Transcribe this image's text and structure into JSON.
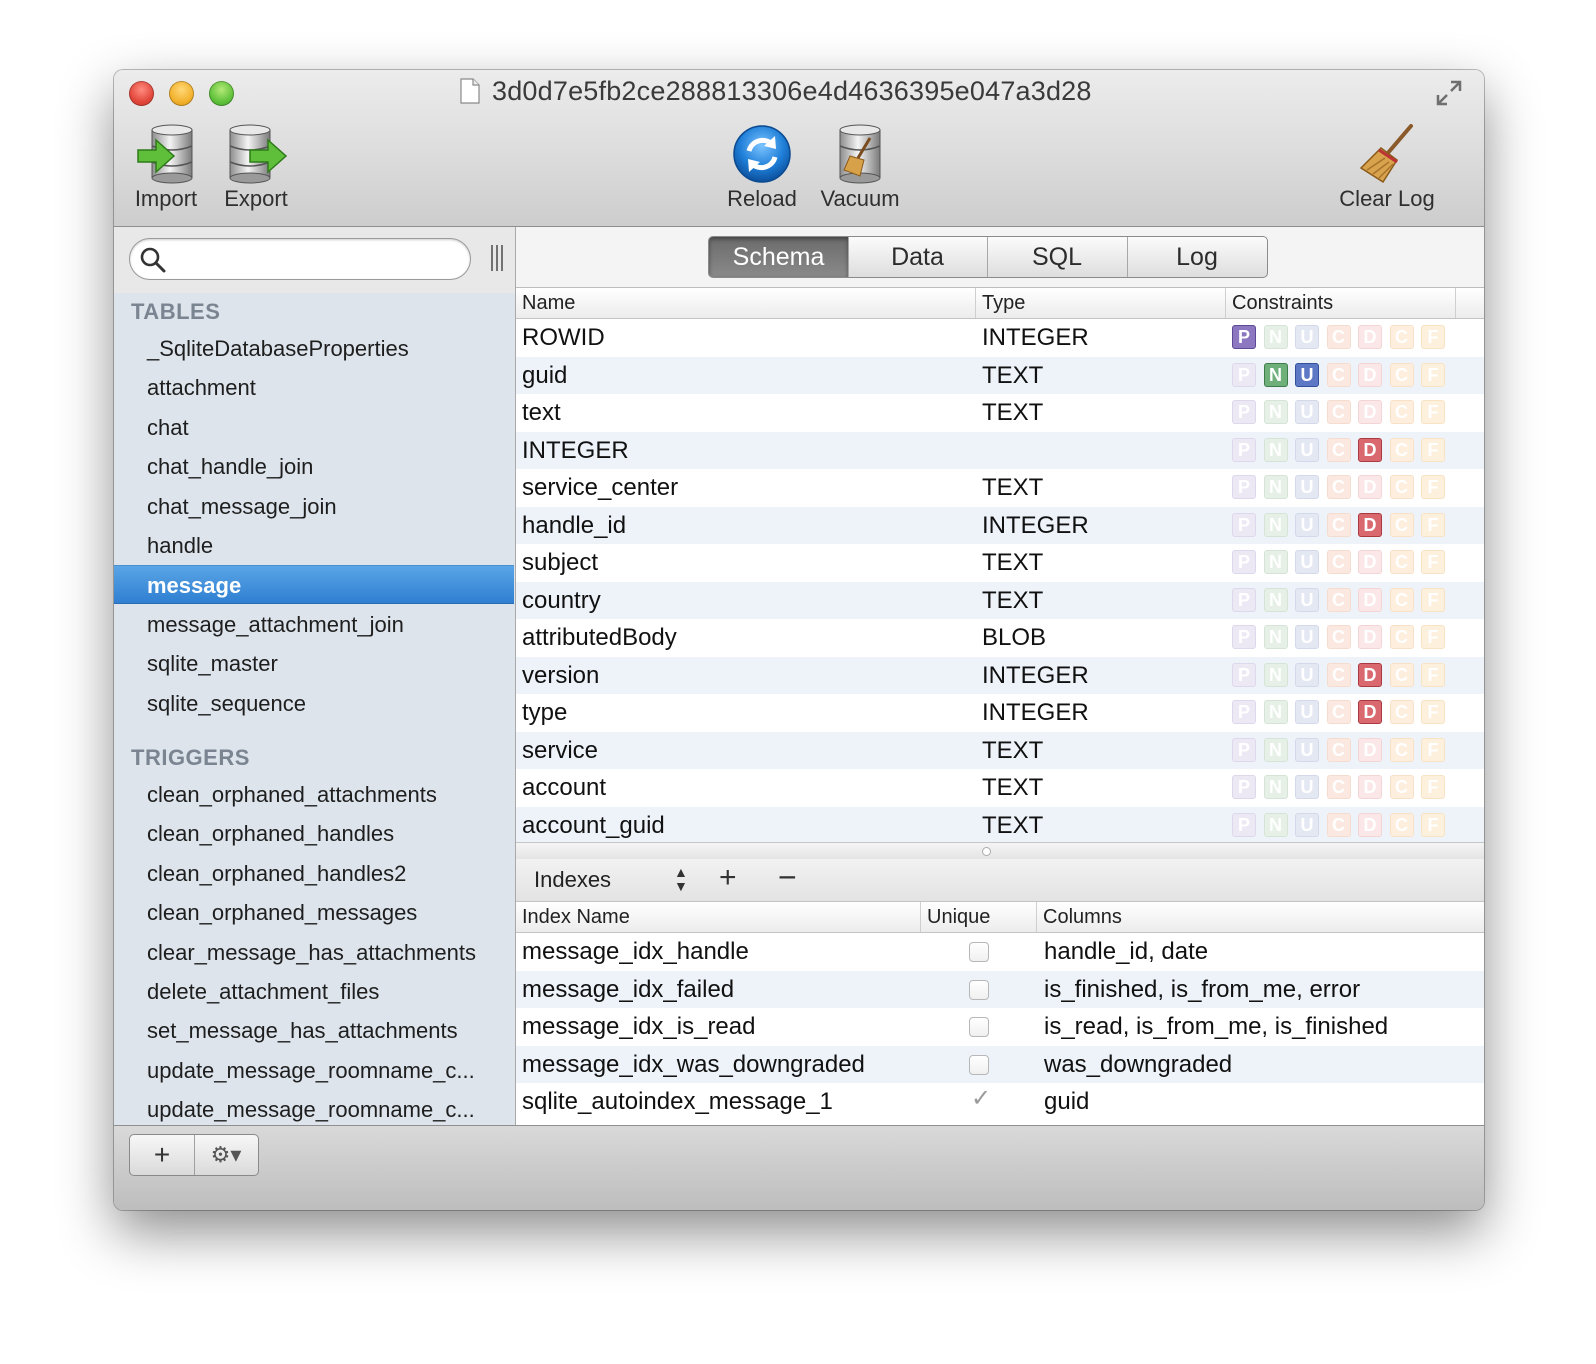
{
  "window": {
    "title": "3d0d7e5fb2ce288813306e4d4636395e047a3d28"
  },
  "toolbar": {
    "import_label": "Import",
    "export_label": "Export",
    "reload_label": "Reload",
    "vacuum_label": "Vacuum",
    "clear_log_label": "Clear Log"
  },
  "search": {
    "value": "",
    "placeholder": ""
  },
  "sidebar": {
    "tables_header": "TABLES",
    "tables": [
      "_SqliteDatabaseProperties",
      "attachment",
      "chat",
      "chat_handle_join",
      "chat_message_join",
      "handle",
      "message",
      "message_attachment_join",
      "sqlite_master",
      "sqlite_sequence"
    ],
    "selected_table": "message",
    "triggers_header": "TRIGGERS",
    "triggers": [
      "clean_orphaned_attachments",
      "clean_orphaned_handles",
      "clean_orphaned_handles2",
      "clean_orphaned_messages",
      "clear_message_has_attachments",
      "delete_attachment_files",
      "set_message_has_attachments",
      "update_message_roomname_c...",
      "update_message_roomname_c..."
    ]
  },
  "tabs": [
    "Schema",
    "Data",
    "SQL",
    "Log"
  ],
  "active_tab": "Schema",
  "schema": {
    "headers": {
      "name": "Name",
      "type": "Type",
      "constraints": "Constraints"
    },
    "constraint_letters": [
      "P",
      "N",
      "U",
      "C",
      "D",
      "C",
      "F"
    ],
    "rows": [
      {
        "name": "ROWID",
        "type": "INTEGER",
        "on": [
          "P"
        ]
      },
      {
        "name": "guid",
        "type": "TEXT",
        "on": [
          "N",
          "U"
        ]
      },
      {
        "name": "text",
        "type": "TEXT",
        "on": []
      },
      {
        "name": "INTEGER",
        "type": "",
        "on": [
          "D"
        ]
      },
      {
        "name": "service_center",
        "type": "TEXT",
        "on": []
      },
      {
        "name": "handle_id",
        "type": "INTEGER",
        "on": [
          "D"
        ]
      },
      {
        "name": "subject",
        "type": "TEXT",
        "on": []
      },
      {
        "name": "country",
        "type": "TEXT",
        "on": []
      },
      {
        "name": "attributedBody",
        "type": "BLOB",
        "on": []
      },
      {
        "name": "version",
        "type": "INTEGER",
        "on": [
          "D"
        ]
      },
      {
        "name": "type",
        "type": "INTEGER",
        "on": [
          "D"
        ]
      },
      {
        "name": "service",
        "type": "TEXT",
        "on": []
      },
      {
        "name": "account",
        "type": "TEXT",
        "on": []
      },
      {
        "name": "account_guid",
        "type": "TEXT",
        "on": []
      }
    ]
  },
  "indexes": {
    "selector_label": "Indexes",
    "add_label": "+",
    "remove_label": "−",
    "headers": {
      "name": "Index Name",
      "unique": "Unique",
      "columns": "Columns"
    },
    "rows": [
      {
        "name": "message_idx_handle",
        "unique": false,
        "columns": "handle_id, date"
      },
      {
        "name": "message_idx_failed",
        "unique": false,
        "columns": "is_finished, is_from_me, error"
      },
      {
        "name": "message_idx_is_read",
        "unique": false,
        "columns": "is_read, is_from_me, is_finished"
      },
      {
        "name": "message_idx_was_downgraded",
        "unique": false,
        "columns": "was_downgraded"
      },
      {
        "name": "sqlite_autoindex_message_1",
        "unique": true,
        "columns": "guid"
      }
    ]
  },
  "bottom": {
    "add_label": "+",
    "gear_label": "⚙▾"
  },
  "icons": {
    "import": "database-import-icon",
    "export": "database-export-icon",
    "reload": "reload-icon",
    "vacuum": "vacuum-icon",
    "clear_log": "broom-icon",
    "search": "search-icon",
    "document": "document-icon",
    "fullscreen": "fullscreen-icon"
  }
}
